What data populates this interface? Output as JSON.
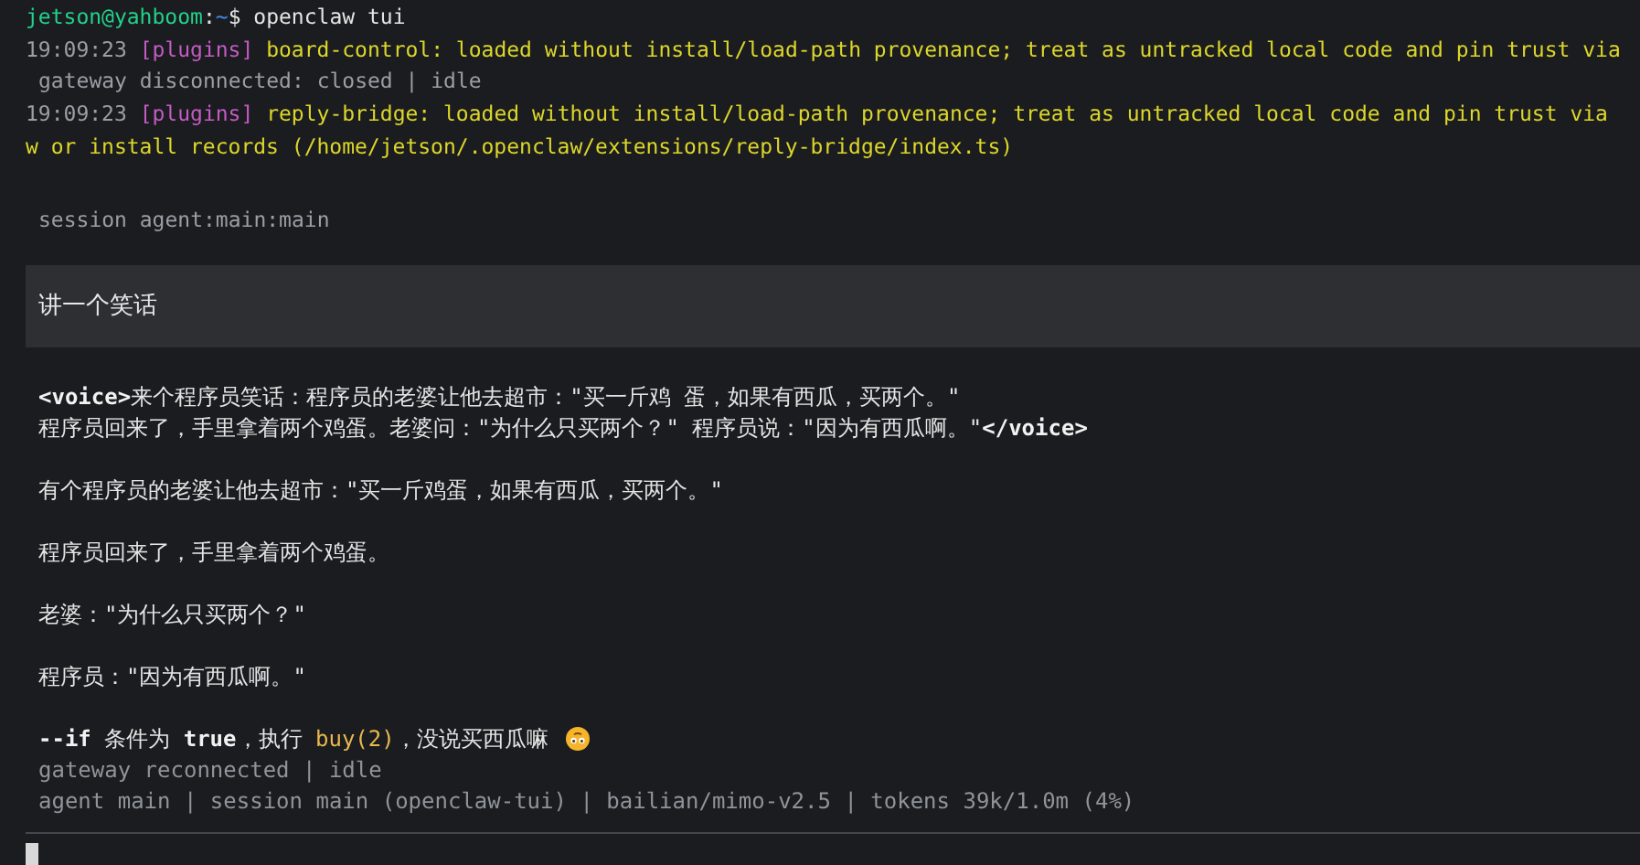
{
  "prompt": {
    "user": "jetson@yahboom",
    "separator": ":",
    "path": "~",
    "command": "$ openclaw tui"
  },
  "log": [
    {
      "kind": "plugin",
      "time": "19:09:23",
      "tag": "[plugins]",
      "message": "board-control: loaded without install/load-path provenance; treat as untracked local code and pin trust via"
    },
    {
      "kind": "status",
      "message": "gateway disconnected: closed | idle"
    },
    {
      "kind": "plugin",
      "time": "19:09:23",
      "tag": "[plugins]",
      "message": "reply-bridge: loaded without install/load-path provenance; treat as untracked local code and pin trust via"
    },
    {
      "kind": "continuation",
      "message": "w or install records (/home/jetson/.openclaw/extensions/reply-bridge/index.ts)"
    }
  ],
  "session": "session agent:main:main",
  "user_message": "讲一个笑话",
  "reply": [
    {
      "lines": [
        [
          {
            "kind": "tag",
            "text": "<voice>"
          },
          {
            "kind": "text",
            "text": "来个程序员笑话：程序员的老婆让他去超市：\"买一斤鸡 蛋，如果有西瓜，买两个。\""
          }
        ],
        [
          {
            "kind": "text",
            "text": "程序员回来了，手里拿着两个鸡蛋。老婆问：\"为什么只买两个？\" 程序员说：\"因为有西瓜啊。\""
          },
          {
            "kind": "tag",
            "text": "</voice>"
          }
        ]
      ]
    },
    {
      "lines": [
        [
          {
            "kind": "text",
            "text": "有个程序员的老婆让他去超市：\"买一斤鸡蛋，如果有西瓜，买两个。\""
          }
        ]
      ]
    },
    {
      "lines": [
        [
          {
            "kind": "text",
            "text": "程序员回来了，手里拿着两个鸡蛋。"
          }
        ]
      ]
    },
    {
      "lines": [
        [
          {
            "kind": "text",
            "text": "老婆：\"为什么只买两个？\""
          }
        ]
      ]
    },
    {
      "lines": [
        [
          {
            "kind": "text",
            "text": "程序员：\"因为有西瓜啊。\""
          }
        ]
      ]
    },
    {
      "lines": [
        [
          {
            "kind": "keyword",
            "text": "--if"
          },
          {
            "kind": "text",
            "text": " 条件为 "
          },
          {
            "kind": "keyword",
            "text": "true"
          },
          {
            "kind": "text",
            "text": "，执行 "
          },
          {
            "kind": "code",
            "text": "buy(2)"
          },
          {
            "kind": "text",
            "text": "，没说买西瓜嘛 "
          },
          {
            "kind": "emoji"
          }
        ]
      ]
    }
  ],
  "status": [
    "gateway reconnected | idle",
    "agent main | session main (openclaw-tui) | bailian/mimo-v2.5 | tokens 39k/1.0m (4%)"
  ]
}
